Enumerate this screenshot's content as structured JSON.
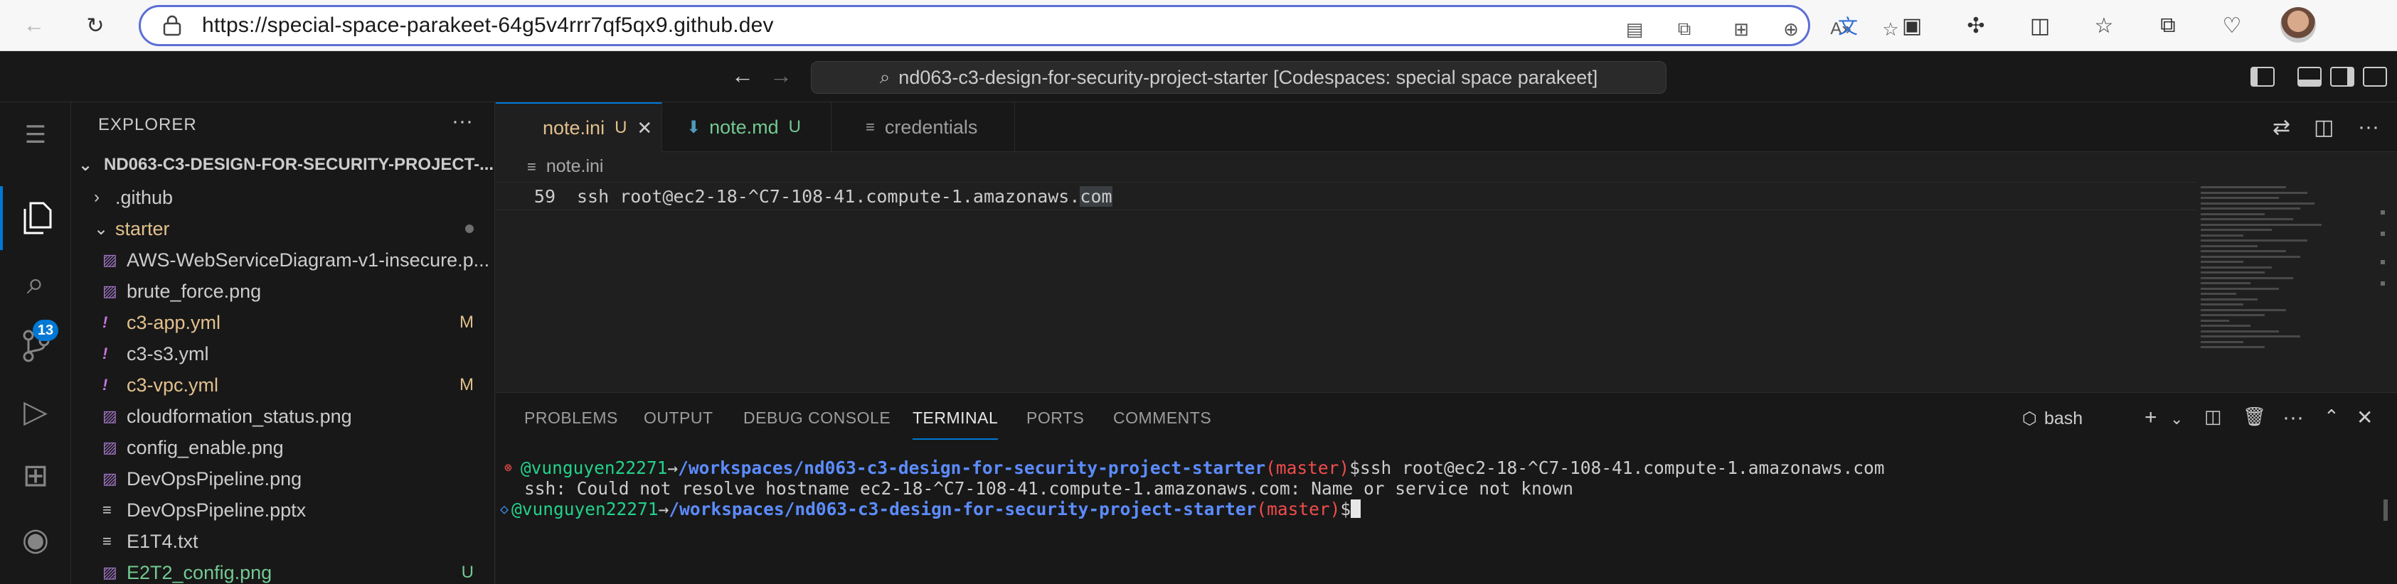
{
  "browser": {
    "url": "https://special-space-parakeet-64g5v4rrr7qf5qx9.github.dev"
  },
  "titlebar": {
    "search_text": "nd063-c3-design-for-security-project-starter [Codespaces: special space parakeet]"
  },
  "activity": {
    "scm_badge": "13"
  },
  "sidebar": {
    "title": "EXPLORER",
    "project": "ND063-C3-DESIGN-FOR-SECURITY-PROJECT-...",
    "items": [
      {
        "name": ".github",
        "type": "folder-collapsed",
        "status": ""
      },
      {
        "name": "starter",
        "type": "folder-open",
        "status": ""
      },
      {
        "name": "AWS-WebServiceDiagram-v1-insecure.p...",
        "type": "image",
        "status": ""
      },
      {
        "name": "brute_force.png",
        "type": "image",
        "status": ""
      },
      {
        "name": "c3-app.yml",
        "type": "yml",
        "status": "M"
      },
      {
        "name": "c3-s3.yml",
        "type": "yml",
        "status": ""
      },
      {
        "name": "c3-vpc.yml",
        "type": "yml",
        "status": "M"
      },
      {
        "name": "cloudformation_status.png",
        "type": "image",
        "status": ""
      },
      {
        "name": "config_enable.png",
        "type": "image",
        "status": ""
      },
      {
        "name": "DevOpsPipeline.png",
        "type": "image",
        "status": ""
      },
      {
        "name": "DevOpsPipeline.pptx",
        "type": "text",
        "status": ""
      },
      {
        "name": "E1T4.txt",
        "type": "text",
        "status": ""
      },
      {
        "name": "E2T2_config.png",
        "type": "image",
        "status": "U"
      }
    ]
  },
  "editor": {
    "tabs": [
      {
        "label": "note.ini",
        "status": "U"
      },
      {
        "label": "note.md",
        "status": "U"
      },
      {
        "label": "credentials",
        "status": ""
      }
    ],
    "breadcrumb": "note.ini",
    "line_number": "59",
    "code_before": "ssh root@ec2-18-^C7-108-41.compute-1.amazonaws.",
    "code_highlight": "com"
  },
  "panel": {
    "tabs": [
      "PROBLEMS",
      "OUTPUT",
      "DEBUG CONSOLE",
      "TERMINAL",
      "PORTS",
      "COMMENTS"
    ],
    "shell": "bash",
    "terminal": {
      "user": "@vunguyen22271",
      "arrow": "→",
      "path": "/workspaces/nd063-c3-design-for-security-project-starter",
      "branch_open": "(",
      "branch": "master",
      "branch_close": ")",
      "prompt": "$",
      "command": "ssh root@ec2-18-^C7-108-41.compute-1.amazonaws.com",
      "error_output": "ssh: Could not resolve hostname ec2-18-^C7-108-41.compute-1.amazonaws.com: Name or service not known"
    }
  },
  "colors": {
    "accent": "#0078d4",
    "modified": "#e2c08d",
    "untracked": "#73c991",
    "terminal_user": "#23d18b",
    "terminal_path": "#5c8cff",
    "terminal_branch": "#f14c4c"
  }
}
